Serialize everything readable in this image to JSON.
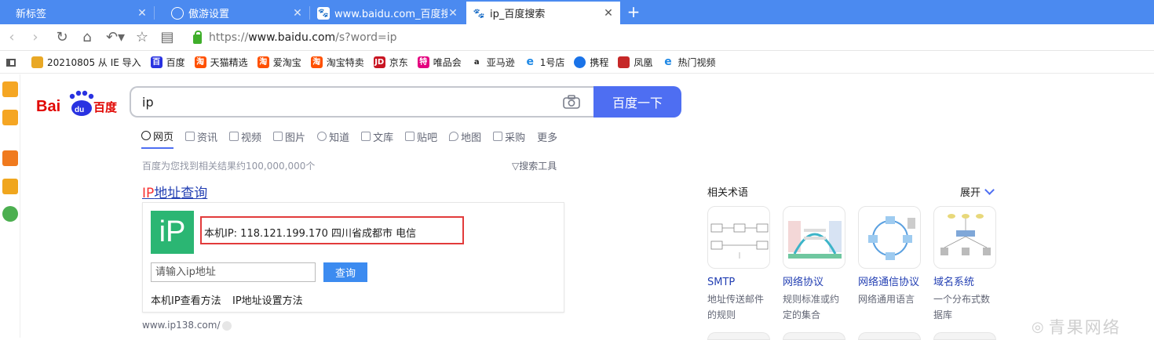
{
  "tabs": [
    {
      "title": "新标签",
      "active": false
    },
    {
      "title": "傲游设置",
      "active": false
    },
    {
      "title": "www.baidu.com_百度搜索",
      "active": false
    },
    {
      "title": "ip_百度搜索",
      "active": true
    }
  ],
  "address": {
    "protocol": "https://",
    "host": "www.baidu.com",
    "path": "/s?word=ip"
  },
  "bookmarks": [
    {
      "label": "20210805 从 IE 导入",
      "icon": "folder-icon",
      "color": "#e9a825"
    },
    {
      "label": "百度",
      "icon": "baidu-icon",
      "color": "#2932e1"
    },
    {
      "label": "天猫精选",
      "icon": "taobao-icon",
      "color": "#ff5000"
    },
    {
      "label": "爱淘宝",
      "icon": "taobao-icon",
      "color": "#ff5000"
    },
    {
      "label": "淘宝特卖",
      "icon": "taobao-icon",
      "color": "#ff5000"
    },
    {
      "label": "京东",
      "icon": "jd-icon",
      "color": "#c91623"
    },
    {
      "label": "唯品会",
      "icon": "vip-icon",
      "color": "#e4007f"
    },
    {
      "label": "亚马逊",
      "icon": "amazon-icon",
      "color": "#222222"
    },
    {
      "label": "1号店",
      "icon": "ie-icon",
      "color": "#1e88e5"
    },
    {
      "label": "携程",
      "icon": "ctrip-icon",
      "color": "#1a73e8"
    },
    {
      "label": "凤凰",
      "icon": "ifeng-icon",
      "color": "#c62828"
    },
    {
      "label": "热门视频",
      "icon": "ie-icon",
      "color": "#1e88e5"
    }
  ],
  "search": {
    "query": "ip",
    "button": "百度一下"
  },
  "search_tabs": [
    "网页",
    "资讯",
    "视频",
    "图片",
    "知道",
    "文库",
    "贴吧",
    "地图",
    "采购",
    "更多"
  ],
  "result_count": "百度为您找到相关结果约100,000,000个",
  "search_tools": "搜索工具",
  "result": {
    "title_em": "IP",
    "title_rest": "地址查询",
    "logo_text": "iP",
    "ip_line": "本机IP: 118.121.199.170   四川省成都市 电信",
    "input_placeholder": "请输入ip地址",
    "query_button": "查询",
    "link1": "本机IP查看方法",
    "link2": "IP地址设置方法",
    "source": "www.ip138.com/"
  },
  "related": {
    "heading": "相关术语",
    "expand": "展开",
    "items": [
      {
        "name": "SMTP",
        "desc": "地址传送邮件的规则"
      },
      {
        "name": "网络协议",
        "desc": "规则标准或约定的集合"
      },
      {
        "name": "网络通信协议",
        "desc": "网络通用语言"
      },
      {
        "name": "域名系统",
        "desc": "一个分布式数据库"
      }
    ]
  },
  "watermark": "青果网络"
}
